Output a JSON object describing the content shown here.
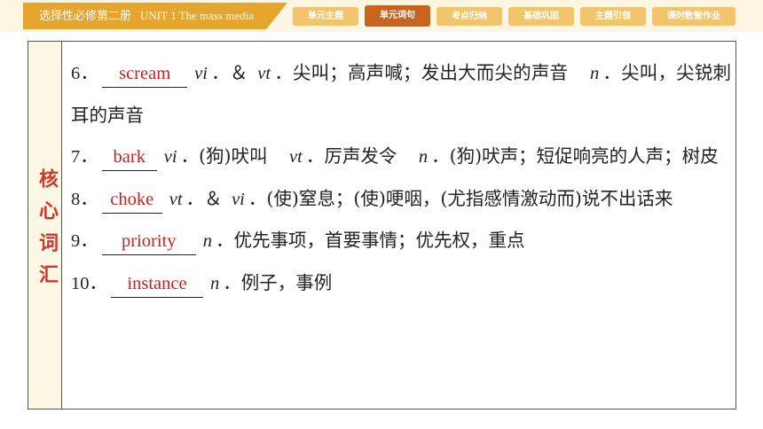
{
  "header": {
    "book": "选择性必修第二册",
    "unit": "UNIT 1 The mass media",
    "tabs": [
      {
        "label": "单元主题",
        "active": false
      },
      {
        "label": "单元词句",
        "active": true
      },
      {
        "label": "考点归纳",
        "active": false
      },
      {
        "label": "基础巩固",
        "active": false
      },
      {
        "label": "主题引领",
        "active": false
      },
      {
        "label": "课时数智作业",
        "active": false
      }
    ]
  },
  "section_label": "核心词汇",
  "entries": [
    {
      "num": "6．",
      "answer": "scream",
      "text1": "vi．＆ vt．尖叫；高声喊；发出大而尖的声音",
      "text2": "n．尖叫，尖锐刺耳的声音"
    },
    {
      "num": "7．",
      "answer": "bark",
      "text1": "vi．(狗)吠叫",
      "text2": "vt．厉声发令",
      "text3": "n．(狗)吠声；短促响亮的人声；树皮"
    },
    {
      "num": "8．",
      "answer": "choke",
      "text1": "vt．＆ vi．(使)窒息；(使)哽咽，(尤指感情激动而)说不出话来"
    },
    {
      "num": "9．",
      "answer": "priority",
      "text1": "n．优先事项，首要事情；优先权，重点"
    },
    {
      "num": "10．",
      "answer": "instance",
      "text1": "n．例子，事例"
    }
  ],
  "colors": {
    "banner": "#e6a52c",
    "tab": "#f2c46b",
    "tab_active": "#c8641e",
    "answer": "#c8221e",
    "label": "#d0362c"
  }
}
